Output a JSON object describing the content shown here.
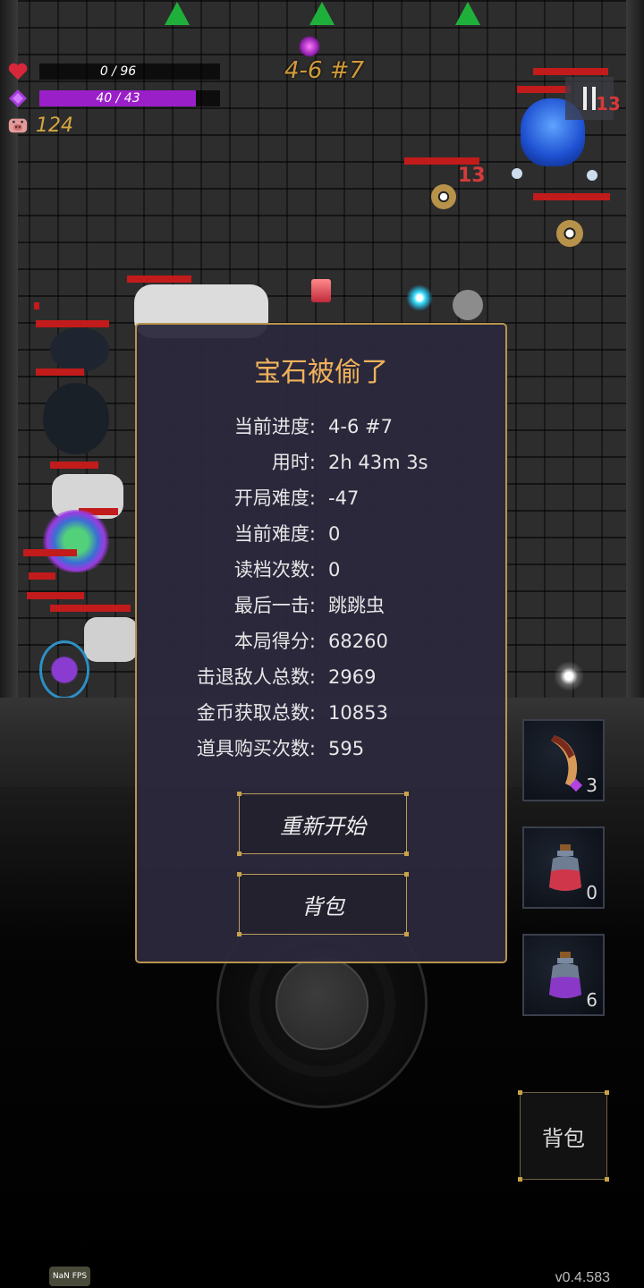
{
  "hud": {
    "hp_text": "0 / 96",
    "hp_fraction": 0.0,
    "mana_text": "40 / 43",
    "mana_fraction": 0.93,
    "coins": "124",
    "stage": "4-6 #7",
    "hp_color": "#c21b1b",
    "mana_color": "#9b1fc9",
    "pause_icon": "pause-icon"
  },
  "field": {
    "damage_numbers": [
      "13",
      "13"
    ]
  },
  "dialog": {
    "title": "宝石被偷了",
    "stats": [
      {
        "label": "当前进度:",
        "value": "4-6 #7"
      },
      {
        "label": "用时:",
        "value": "2h 43m 3s"
      },
      {
        "label": "开局难度:",
        "value": "-47"
      },
      {
        "label": "当前难度:",
        "value": "0"
      },
      {
        "label": "读档次数:",
        "value": "0"
      },
      {
        "label": "最后一击:",
        "value": "跳跳虫"
      },
      {
        "label": "本局得分:",
        "value": "68260"
      },
      {
        "label": "击退敌人总数:",
        "value": "2969"
      },
      {
        "label": "金币获取总数:",
        "value": "10853"
      },
      {
        "label": "道具购买次数:",
        "value": "595"
      }
    ],
    "restart_label": "重新开始",
    "bag_label": "背包"
  },
  "items": [
    {
      "icon": "horn-icon",
      "count": "3",
      "cost_gem": true
    },
    {
      "icon": "red-potion-icon",
      "count": "0"
    },
    {
      "icon": "purple-potion-icon",
      "count": "6"
    }
  ],
  "side_bag_label": "背包",
  "footer": {
    "fps": "NaN FPS",
    "version": "v0.4.583"
  }
}
